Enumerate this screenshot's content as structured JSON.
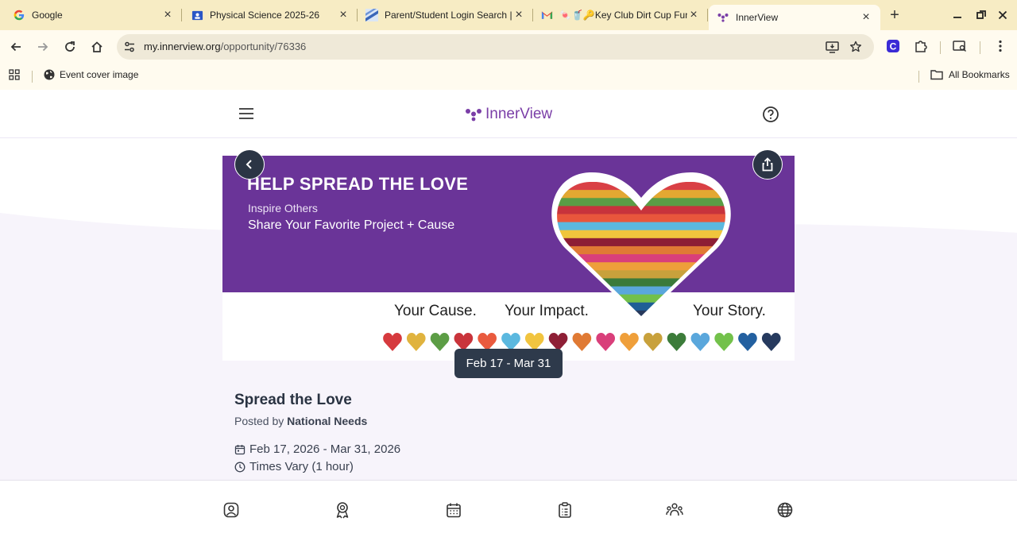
{
  "browser": {
    "tabs": [
      {
        "title": "Google",
        "icon": "google-icon"
      },
      {
        "title": "Physical Science 2025-26",
        "icon": "classroom-icon"
      },
      {
        "title": "Parent/Student Login Search |",
        "icon": "school-logo-icon"
      },
      {
        "title": "🍬🥤🔑Key Club Dirt Cup Fun",
        "icon": "gmail-icon"
      },
      {
        "title": "InnerView",
        "icon": "innerview-icon",
        "active": true
      }
    ],
    "url_host": "my.innerview.org",
    "url_path": "/opportunity/76336",
    "bookmarks": [
      {
        "label": "Event cover image",
        "icon": "globe-icon"
      }
    ],
    "all_bookmarks_label": "All Bookmarks"
  },
  "app": {
    "brand": "InnerView",
    "brand_color": "#7a3ea7"
  },
  "banner": {
    "headline": "HELP SPREAD THE LOVE",
    "subline1": "Inspire Others",
    "subline2": "Share Your Favorite Project + Cause",
    "caption_cause": "Your Cause.",
    "caption_impact": "Your Impact.",
    "caption_story": "Your Story.",
    "background_color": "#6a3498",
    "stripe_colors": [
      "#d94045",
      "#e3a832",
      "#5a9d45",
      "#c7333c",
      "#e8563c",
      "#5bb8df",
      "#f0c53d",
      "#8d1e35",
      "#e07a34",
      "#d93f7a",
      "#ee9f3a",
      "#c8a13c",
      "#3a7a3a",
      "#5aa7dc",
      "#72c04a",
      "#1f5e96",
      "#27395c"
    ],
    "heart_colors": [
      "#d63a3e",
      "#e0b33e",
      "#5c9d45",
      "#c9343b",
      "#e95a3e",
      "#5bb8df",
      "#f1c43f",
      "#8e1f36",
      "#e07a34",
      "#d93f7a",
      "#ef9f3a",
      "#c8a13c",
      "#3c7c3a",
      "#5aa7dc",
      "#73c14b",
      "#2360a0",
      "#263a5e"
    ]
  },
  "date_badge": "Feb 17 - Mar 31",
  "event": {
    "title": "Spread the Love",
    "posted_by_prefix": "Posted by",
    "posted_by": "National Needs",
    "date_range": "Feb 17, 2026 - Mar 31, 2026",
    "time": "Times Vary (1 hour)"
  },
  "bottom_nav": [
    {
      "name": "profile",
      "icon": "profile-icon"
    },
    {
      "name": "badges",
      "icon": "ribbon-icon"
    },
    {
      "name": "calendar",
      "icon": "calendar-icon"
    },
    {
      "name": "tasks",
      "icon": "clipboard-icon"
    },
    {
      "name": "community",
      "icon": "people-icon"
    },
    {
      "name": "explore",
      "icon": "globe-icon"
    }
  ]
}
